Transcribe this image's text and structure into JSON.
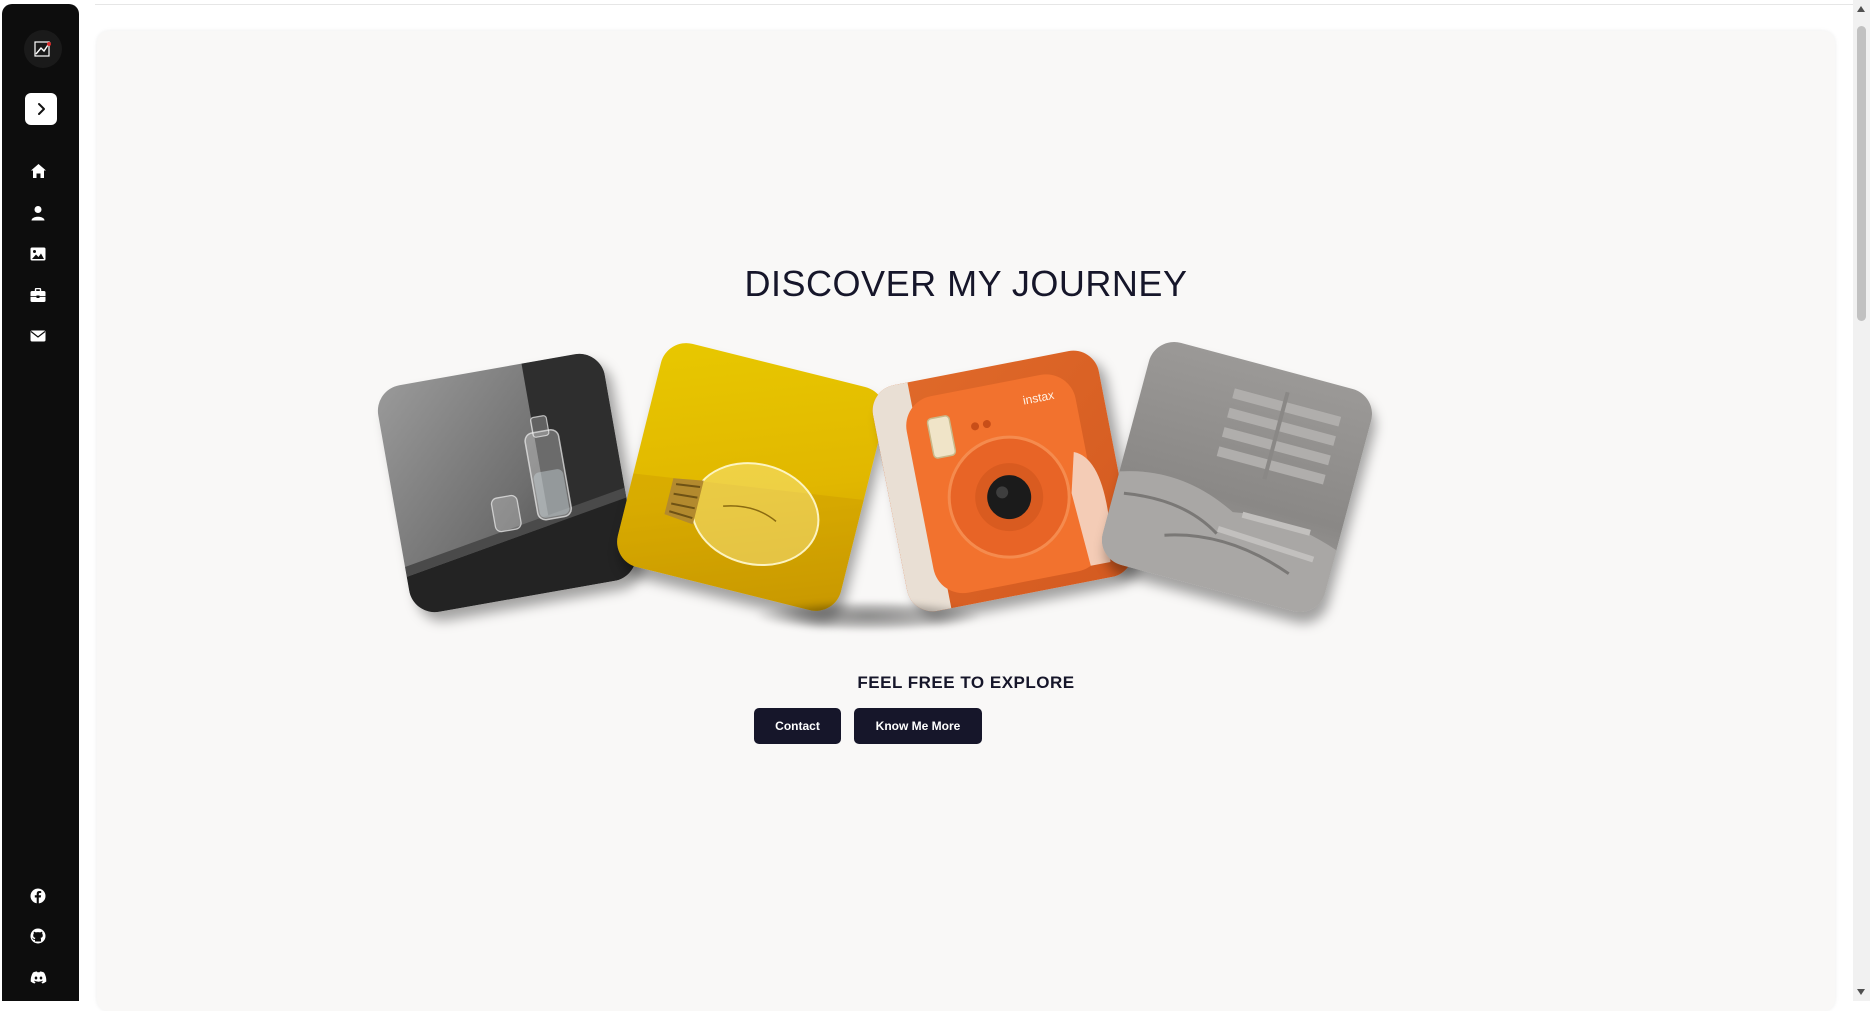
{
  "sidebar": {
    "nav": [
      {
        "icon": "home-icon"
      },
      {
        "icon": "user-icon"
      },
      {
        "icon": "image-icon"
      },
      {
        "icon": "briefcase-icon"
      },
      {
        "icon": "mail-icon"
      }
    ],
    "social": [
      {
        "icon": "facebook-icon"
      },
      {
        "icon": "github-icon"
      },
      {
        "icon": "discord-icon"
      }
    ]
  },
  "hero": {
    "title": "DISCOVER MY JOURNEY",
    "subtitle": "FEEL FREE TO EXPLORE",
    "buttons": {
      "contact": "Contact",
      "know_more": "Know Me More"
    }
  },
  "gallery": [
    {
      "subject": "glass carafe and tumbler",
      "color": "#6e6e6e"
    },
    {
      "subject": "light bulb",
      "color": "#e1b700"
    },
    {
      "subject": "instax camera",
      "color": "#d45a20"
    },
    {
      "subject": "shadowed bed",
      "color": "#8a8886"
    }
  ],
  "colors": {
    "accent": "#16162a",
    "sidebar": "#0d0d0d",
    "background": "#f9f8f7"
  }
}
